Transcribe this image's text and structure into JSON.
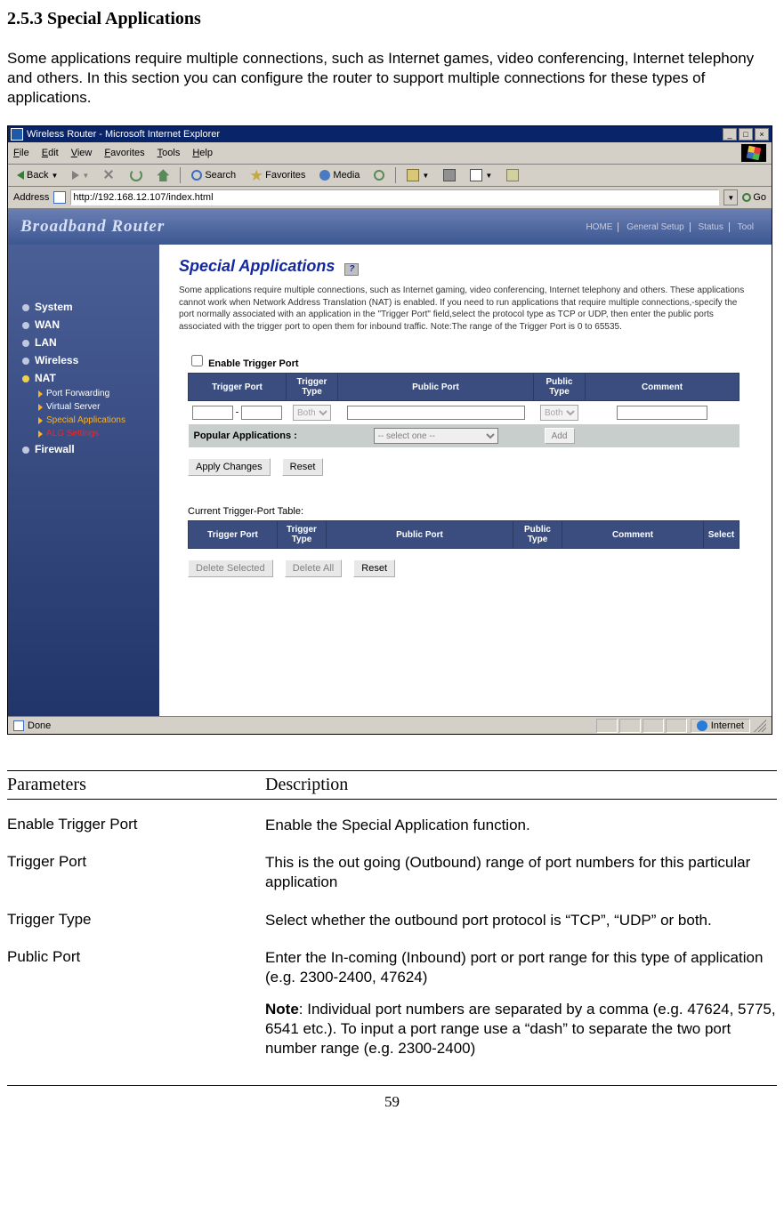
{
  "section_number": "2.5.3 Special Applications",
  "intro": "Some applications require multiple connections, such as Internet games, video conferencing, Internet telephony and others. In this section you can configure the router to support multiple connections for these types of applications.",
  "browser": {
    "title": "Wireless Router - Microsoft Internet Explorer",
    "menus": [
      "File",
      "Edit",
      "View",
      "Favorites",
      "Tools",
      "Help"
    ],
    "toolbar": {
      "back": "Back",
      "search": "Search",
      "favorites": "Favorites",
      "media": "Media"
    },
    "address_label": "Address",
    "address_value": "http://192.168.12.107/index.html",
    "go_label": "Go"
  },
  "page": {
    "brand": "Broadband Router",
    "topnav": [
      "HOME",
      "General Setup",
      "Status",
      "Tool"
    ],
    "sidebar": {
      "items": [
        "System",
        "WAN",
        "LAN",
        "Wireless",
        "NAT"
      ],
      "subs": [
        "Port Forwarding",
        "Virtual Server",
        "Special Applications",
        "ALG Settings"
      ],
      "last": "Firewall"
    },
    "main": {
      "title": "Special Applications",
      "desc": "Some applications require multiple connections, such as Internet gaming, video conferencing, Internet telephony and others. These applications cannot work when Network Address Translation (NAT) is enabled. If you need to run applications that require multiple connections,-specify the port normally associated with an application in the \"Trigger Port\" field,select the protocol type as TCP or UDP, then enter the public ports associated with the trigger port to open them for inbound traffic. Note:The range of the Trigger Port is 0 to 65535.",
      "enable_label": "Enable Trigger Port",
      "columns": [
        "Trigger Port",
        "Trigger Type",
        "Public Port",
        "Public Type",
        "Comment"
      ],
      "trigger_type_value": "Both",
      "public_type_value": "Both",
      "popular_label": "Popular Applications :",
      "popular_select": "-- select one --",
      "add_btn": "Add",
      "apply_btn": "Apply Changes",
      "reset_btn": "Reset",
      "current_title": "Current Trigger-Port Table:",
      "columns2": [
        "Trigger Port",
        "Trigger Type",
        "Public Port",
        "Public Type",
        "Comment",
        "Select"
      ],
      "delete_selected": "Delete Selected",
      "delete_all": "Delete All",
      "reset2": "Reset"
    }
  },
  "status": {
    "done": "Done",
    "zone": "Internet"
  },
  "params": {
    "header": {
      "p": "Parameters",
      "d": "Description"
    },
    "rows": [
      {
        "p": "Enable Trigger Port",
        "d": "Enable the Special Application function."
      },
      {
        "p": "Trigger Port",
        "d": "This is the out going (Outbound) range of port numbers for this particular application"
      },
      {
        "p": "Trigger Type",
        "d": "Select whether the outbound port protocol is “TCP”, “UDP” or both."
      },
      {
        "p": "Public Port",
        "d": "Enter the In-coming (Inbound) port or port range for this type of application (e.g. 2300-2400, 47624)"
      }
    ],
    "note_label": "Note",
    "note_body": ": Individual port numbers are separated by a comma (e.g. 47624, 5775, 6541 etc.). To input a port range use a “dash” to separate the two port number range (e.g. 2300-2400)"
  },
  "page_number": "59"
}
